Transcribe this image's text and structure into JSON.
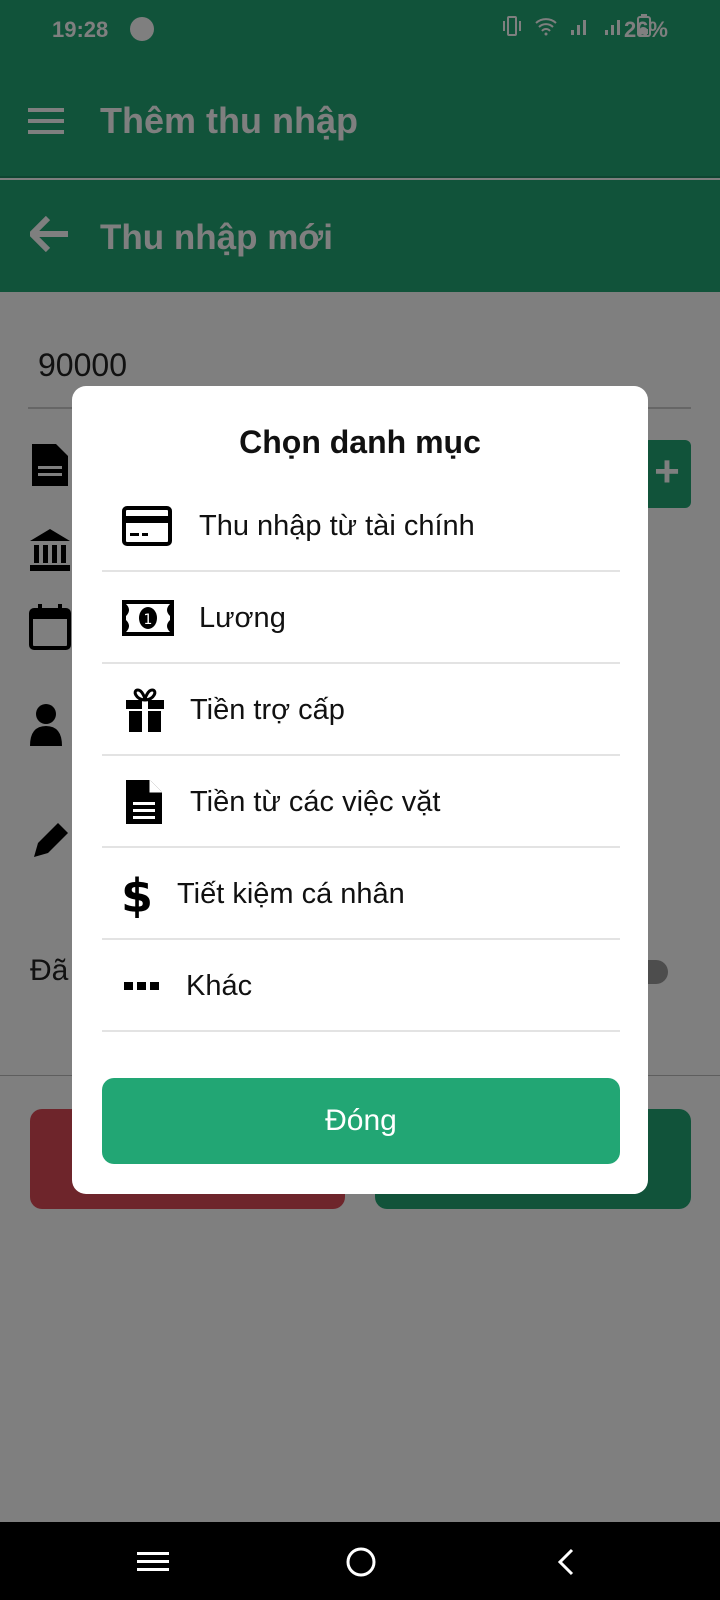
{
  "status_bar": {
    "time": "19:28",
    "battery": "26%"
  },
  "app_bar": {
    "title": "Thêm thu nhập"
  },
  "sub_bar": {
    "title": "Thu nhập mới"
  },
  "form": {
    "amount": "90000",
    "paid_label": "Đã"
  },
  "dialog": {
    "title": "Chọn danh mục",
    "items": [
      {
        "label": "Thu nhập từ tài chính",
        "icon": "credit-card-icon"
      },
      {
        "label": "Lương",
        "icon": "money-bill-icon"
      },
      {
        "label": "Tiền trợ cấp",
        "icon": "gift-icon"
      },
      {
        "label": "Tiền từ các việc vặt",
        "icon": "file-icon"
      },
      {
        "label": "Tiết kiệm cá nhân",
        "icon": "dollar-icon"
      },
      {
        "label": "Khác",
        "icon": "more-icon"
      }
    ],
    "close_label": "Đóng"
  },
  "colors": {
    "primary": "#22a674",
    "danger": "#dc4b56",
    "overlay": "rgba(0,0,0,0.5)"
  }
}
